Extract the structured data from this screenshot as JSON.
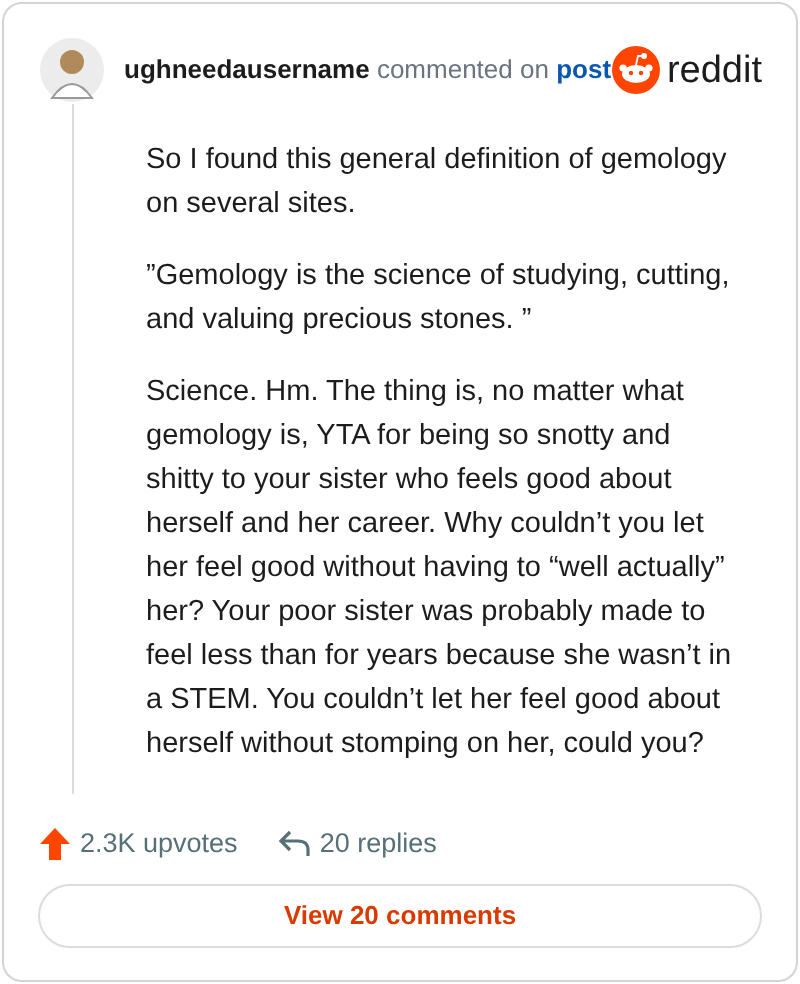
{
  "header": {
    "username": "ughneedausername",
    "action": "commented on",
    "link": "post",
    "brand": "reddit"
  },
  "paragraphs": [
    "So I found this general definition of gemology on several sites.",
    "”Gemology is the science of studying, cutting, and valuing precious stones. ”",
    "Science. Hm. The thing is, no matter what gemology is, YTA for being so snotty and shitty to your sister who feels good about herself and her career. Why couldn’t you let her feel good without having to “well actually” her? Your poor sister was probably made to feel less than for years because she wasn’t in a STEM. You couldn’t let her feel good about herself without stomping on her, could you?"
  ],
  "footer": {
    "upvotes": "2.3K upvotes",
    "replies": "20 replies",
    "button": "View 20 comments"
  }
}
